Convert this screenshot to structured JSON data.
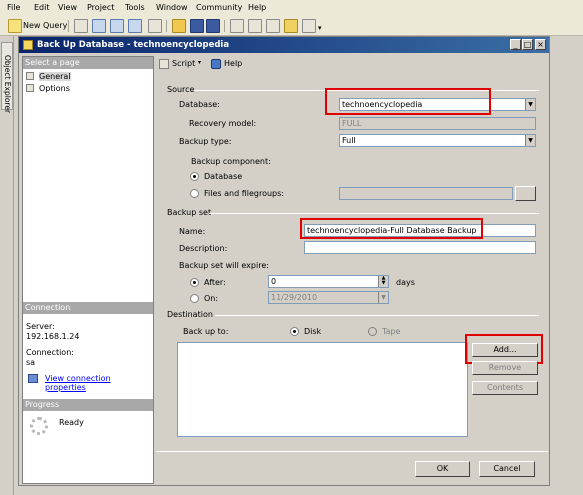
{
  "menubar": {
    "items": [
      "File",
      "Edit",
      "View",
      "Project",
      "Tools",
      "Window",
      "Community",
      "Help"
    ]
  },
  "toolbar": {
    "new_query_label": "New Query"
  },
  "explorer": {
    "tab_label": "Object Explorer"
  },
  "dialog": {
    "title": "Back Up Database - technoencyclopedia",
    "left_pane": {
      "select_page_header": "Select a page",
      "pages": [
        "General",
        "Options"
      ],
      "connection_header": "Connection",
      "server_label": "Server:",
      "server_value": "192.168.1.24",
      "connection_label": "Connection:",
      "connection_value": "sa",
      "view_connection_link": "View connection properties",
      "progress_header": "Progress",
      "progress_status": "Ready"
    },
    "toolbar": {
      "script_label": "Script",
      "help_label": "Help"
    },
    "source": {
      "section_label": "Source",
      "database_label": "Database:",
      "database_value": "technoencyclopedia",
      "recovery_model_label": "Recovery model:",
      "recovery_model_value": "FULL",
      "backup_type_label": "Backup type:",
      "backup_type_value": "Full",
      "backup_component_label": "Backup component:",
      "component_database_label": "Database",
      "component_files_label": "Files and filegroups:"
    },
    "backup_set": {
      "section_label": "Backup set",
      "name_label": "Name:",
      "name_value": "technoencyclopedia-Full Database Backup",
      "description_label": "Description:",
      "description_value": "",
      "expire_label": "Backup set will expire:",
      "after_label": "After:",
      "after_value": "0",
      "days_label": "days",
      "on_label": "On:",
      "on_value": "11/29/2010"
    },
    "destination": {
      "section_label": "Destination",
      "backup_to_label": "Back up to:",
      "disk_label": "Disk",
      "tape_label": "Tape",
      "add_button": "Add...",
      "remove_button": "Remove",
      "contents_button": "Contents"
    },
    "ok_button": "OK",
    "cancel_button": "Cancel"
  }
}
